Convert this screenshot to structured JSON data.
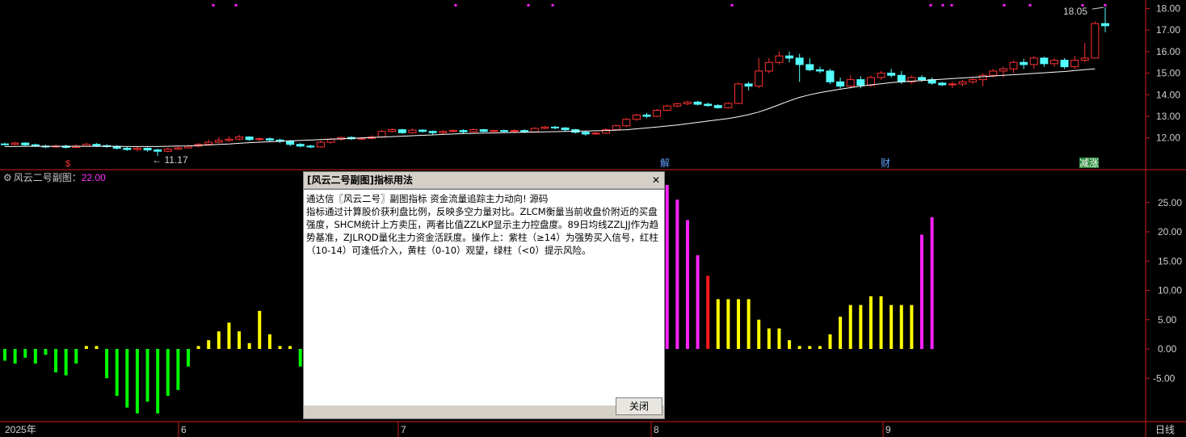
{
  "colors": {
    "up": "#ff3232",
    "down": "#54ffff",
    "ma": "#ffffff",
    "axis": "#c81e1e",
    "bar_purple": "#ff22ff",
    "bar_red": "#ff1a1a",
    "bar_yellow": "#ffff00",
    "bar_green": "#00ff00",
    "marker_purple": "#ff22ff",
    "label_blue": "#5fa0ff"
  },
  "chart_data": [
    {
      "type": "candlestick",
      "name": "main",
      "ylim": [
        11.0,
        18.2
      ],
      "yticks": [
        "18.00",
        "17.00",
        "16.00",
        "15.00",
        "14.00",
        "13.00",
        "12.00"
      ],
      "yticks_values": [
        18,
        17,
        16,
        15,
        14,
        13,
        12
      ],
      "high_annotation": "18.05",
      "low_annotation": "11.17",
      "candles": [
        [
          11.72,
          11.7,
          11.78,
          11.64
        ],
        [
          11.7,
          11.76,
          11.82,
          11.66
        ],
        [
          11.76,
          11.68,
          11.8,
          11.62
        ],
        [
          11.68,
          11.62,
          11.74,
          11.58
        ],
        [
          11.62,
          11.58,
          11.68,
          11.52
        ],
        [
          11.58,
          11.62,
          11.7,
          11.54
        ],
        [
          11.62,
          11.56,
          11.68,
          11.5
        ],
        [
          11.56,
          11.62,
          11.7,
          11.52
        ],
        [
          11.62,
          11.7,
          11.78,
          11.58
        ],
        [
          11.7,
          11.64,
          11.76,
          11.58
        ],
        [
          11.64,
          11.6,
          11.7,
          11.54
        ],
        [
          11.6,
          11.52,
          11.66,
          11.46
        ],
        [
          11.52,
          11.46,
          11.58,
          11.4
        ],
        [
          11.46,
          11.52,
          11.58,
          11.38
        ],
        [
          11.52,
          11.44,
          11.56,
          11.36
        ],
        [
          11.44,
          11.38,
          11.5,
          11.17
        ],
        [
          11.38,
          11.48,
          11.54,
          11.34
        ],
        [
          11.48,
          11.54,
          11.6,
          11.44
        ],
        [
          11.54,
          11.62,
          11.68,
          11.5
        ],
        [
          11.62,
          11.7,
          11.76,
          11.58
        ],
        [
          11.7,
          11.8,
          11.92,
          11.66
        ],
        [
          11.8,
          11.88,
          12.04,
          11.76
        ],
        [
          11.88,
          11.94,
          12.08,
          11.82
        ],
        [
          11.94,
          12.04,
          12.14,
          11.88
        ],
        [
          12.04,
          11.92,
          12.08,
          11.86
        ],
        [
          11.92,
          11.96,
          12.02,
          11.86
        ],
        [
          11.96,
          11.9,
          12.02,
          11.84
        ],
        [
          11.9,
          11.84,
          11.96,
          11.76
        ],
        [
          11.84,
          11.7,
          11.9,
          11.62
        ],
        [
          11.7,
          11.62,
          11.76,
          11.56
        ],
        [
          11.62,
          11.58,
          11.68,
          11.52
        ],
        [
          11.58,
          11.8,
          11.88,
          11.54
        ],
        [
          11.8,
          11.94,
          12.0,
          11.74
        ],
        [
          11.94,
          12.02,
          12.06,
          11.86
        ],
        [
          12.02,
          11.96,
          12.08,
          11.9
        ],
        [
          11.96,
          11.98,
          12.04,
          11.9
        ],
        [
          11.98,
          12.04,
          12.12,
          11.92
        ],
        [
          12.04,
          12.3,
          12.36,
          12.0
        ],
        [
          12.3,
          12.38,
          12.44,
          12.24
        ],
        [
          12.38,
          12.24,
          12.42,
          12.2
        ],
        [
          12.24,
          12.36,
          12.44,
          12.2
        ],
        [
          12.36,
          12.3,
          12.4,
          12.24
        ],
        [
          12.3,
          12.24,
          12.34,
          12.16
        ],
        [
          12.24,
          12.3,
          12.36,
          12.18
        ],
        [
          12.3,
          12.34,
          12.4,
          12.26
        ],
        [
          12.34,
          12.28,
          12.4,
          12.22
        ],
        [
          12.28,
          12.38,
          12.44,
          12.24
        ],
        [
          12.38,
          12.3,
          12.42,
          12.26
        ],
        [
          12.3,
          12.34,
          12.38,
          12.26
        ],
        [
          12.34,
          12.3,
          12.38,
          12.24
        ],
        [
          12.3,
          12.34,
          12.4,
          12.26
        ],
        [
          12.34,
          12.28,
          12.4,
          12.22
        ],
        [
          12.28,
          12.44,
          12.5,
          12.24
        ],
        [
          12.44,
          12.5,
          12.56,
          12.4
        ],
        [
          12.5,
          12.46,
          12.56,
          12.4
        ],
        [
          12.46,
          12.38,
          12.5,
          12.3
        ],
        [
          12.38,
          12.26,
          12.42,
          12.2
        ],
        [
          12.26,
          12.18,
          12.32,
          12.1
        ],
        [
          12.18,
          12.22,
          12.28,
          12.14
        ],
        [
          12.22,
          12.38,
          12.44,
          12.18
        ],
        [
          12.38,
          12.56,
          12.62,
          12.34
        ],
        [
          12.56,
          12.86,
          12.92,
          12.5
        ],
        [
          12.86,
          13.06,
          13.12,
          12.78
        ],
        [
          13.06,
          13.0,
          13.16,
          12.92
        ],
        [
          13.0,
          13.28,
          13.34,
          12.96
        ],
        [
          13.28,
          13.48,
          13.54,
          13.24
        ],
        [
          13.48,
          13.58,
          13.62,
          13.42
        ],
        [
          13.58,
          13.66,
          13.72,
          13.52
        ],
        [
          13.66,
          13.56,
          13.72,
          13.5
        ],
        [
          13.56,
          13.5,
          13.64,
          13.44
        ],
        [
          13.5,
          13.4,
          13.56,
          13.36
        ],
        [
          13.4,
          13.6,
          13.66,
          13.36
        ],
        [
          13.6,
          14.5,
          14.58,
          13.56
        ],
        [
          14.5,
          14.4,
          14.6,
          14.2
        ],
        [
          14.4,
          15.1,
          15.7,
          14.3
        ],
        [
          15.1,
          15.5,
          15.7,
          15.0
        ],
        [
          15.5,
          15.8,
          16.0,
          15.4
        ],
        [
          15.8,
          15.7,
          16.0,
          15.5
        ],
        [
          15.7,
          15.4,
          15.9,
          14.6
        ],
        [
          15.4,
          15.16,
          15.7,
          15.1
        ],
        [
          15.16,
          15.1,
          15.3,
          15.0
        ],
        [
          15.1,
          14.6,
          15.2,
          14.5
        ],
        [
          14.6,
          14.4,
          14.8,
          14.3
        ],
        [
          14.4,
          14.7,
          14.9,
          14.3
        ],
        [
          14.7,
          14.44,
          14.86,
          14.3
        ],
        [
          14.44,
          14.8,
          14.9,
          14.36
        ],
        [
          14.8,
          15.0,
          15.1,
          14.7
        ],
        [
          15.0,
          14.9,
          15.2,
          14.8
        ],
        [
          14.9,
          14.6,
          15.1,
          14.5
        ],
        [
          14.6,
          14.8,
          14.9,
          14.5
        ],
        [
          14.8,
          14.7,
          14.9,
          14.6
        ],
        [
          14.7,
          14.54,
          14.8,
          14.46
        ],
        [
          14.54,
          14.46,
          14.6,
          14.4
        ],
        [
          14.46,
          14.5,
          14.6,
          14.3
        ],
        [
          14.5,
          14.6,
          14.7,
          14.4
        ],
        [
          14.6,
          14.7,
          14.8,
          14.5
        ],
        [
          14.7,
          14.9,
          15.0,
          14.4
        ],
        [
          14.9,
          15.1,
          15.2,
          14.8
        ],
        [
          15.1,
          15.2,
          15.3,
          14.8
        ],
        [
          15.2,
          15.5,
          15.6,
          15.0
        ],
        [
          15.5,
          15.4,
          15.66,
          15.2
        ],
        [
          15.4,
          15.7,
          15.8,
          15.2
        ],
        [
          15.7,
          15.44,
          15.76,
          15.3
        ],
        [
          15.44,
          15.6,
          15.7,
          15.3
        ],
        [
          15.6,
          15.3,
          15.7,
          15.2
        ],
        [
          15.3,
          15.6,
          15.8,
          15.2
        ],
        [
          15.6,
          15.7,
          16.4,
          15.5
        ],
        [
          15.7,
          17.3,
          17.4,
          15.7
        ],
        [
          17.3,
          17.2,
          18.05,
          16.9
        ]
      ],
      "ma": [
        11.6,
        11.6,
        11.61,
        11.61,
        11.61,
        11.61,
        11.61,
        11.61,
        11.61,
        11.61,
        11.61,
        11.61,
        11.6,
        11.6,
        11.6,
        11.6,
        11.61,
        11.62,
        11.63,
        11.65,
        11.67,
        11.7,
        11.72,
        11.75,
        11.78,
        11.8,
        11.82,
        11.84,
        11.86,
        11.88,
        11.9,
        11.92,
        11.94,
        11.96,
        11.98,
        12.0,
        12.02,
        12.04,
        12.06,
        12.08,
        12.1,
        12.12,
        12.14,
        12.16,
        12.18,
        12.2,
        12.21,
        12.22,
        12.23,
        12.24,
        12.25,
        12.26,
        12.27,
        12.28,
        12.29,
        12.3,
        12.31,
        12.32,
        12.33,
        12.34,
        12.36,
        12.38,
        12.42,
        12.46,
        12.5,
        12.55,
        12.6,
        12.66,
        12.72,
        12.78,
        12.84,
        12.9,
        12.98,
        13.08,
        13.2,
        13.36,
        13.54,
        13.72,
        13.88,
        14.0,
        14.1,
        14.18,
        14.26,
        14.33,
        14.4,
        14.46,
        14.51,
        14.56,
        14.6,
        14.63,
        14.66,
        14.69,
        14.72,
        14.75,
        14.78,
        14.81,
        14.84,
        14.87,
        14.9,
        14.93,
        14.96,
        14.99,
        15.02,
        15.05,
        15.08,
        15.12,
        15.16,
        15.2
      ]
    },
    {
      "type": "bar",
      "name": "sub",
      "title": "风云二号副图",
      "current_value": "22.00",
      "ylim": [
        -11.0,
        30.5
      ],
      "yticks": [
        "25.00",
        "20.00",
        "15.00",
        "10.00",
        "5.00",
        "0.00",
        "-5.00"
      ],
      "yticks_values": [
        25,
        20,
        15,
        10,
        5,
        0,
        -5
      ],
      "values": [
        -2.0,
        -2.5,
        -1.5,
        -2.5,
        -1.0,
        -4.0,
        -4.5,
        -2.5,
        0.5,
        0.5,
        -5.0,
        -8.0,
        -10.0,
        -11.0,
        -9.0,
        -11.0,
        -8.0,
        -7.0,
        -3.0,
        0.5,
        1.5,
        3.0,
        4.5,
        3.0,
        1.0,
        6.5,
        2.5,
        0.5,
        0.5,
        -3.0,
        0.5,
        1.0,
        3.0,
        5.5,
        6.5,
        7.0,
        8.0,
        9.0,
        10.0,
        10.5,
        11.0,
        11.5,
        12.0,
        12.5,
        13.0,
        14.0,
        14.5,
        15.0,
        16.0,
        17.0,
        18.0,
        2.5,
        5.5,
        9.5,
        12.0,
        15.5,
        18.0,
        20.5,
        18.0,
        16.5,
        15.0,
        13.5,
        22.0,
        25.5,
        28.0,
        28.0,
        25.5,
        22.0,
        16.0,
        12.5,
        8.5,
        8.5,
        8.5,
        8.5,
        5.0,
        3.5,
        3.5,
        1.5,
        0.5,
        0.5,
        0.5,
        2.5,
        5.5,
        7.5,
        7.5,
        9.0,
        9.0,
        7.5,
        7.5,
        7.5,
        19.5,
        22.5
      ]
    }
  ],
  "x_axis": {
    "labels": [
      "2025年",
      "6",
      "7",
      "8",
      "9"
    ]
  },
  "top_markers": {
    "signal_label": "$",
    "event_labels": [
      "解",
      "财",
      "减涨"
    ]
  },
  "period_label": "日线",
  "dialog": {
    "title": "[风云二号副图]指标用法",
    "body": "通达信〖风云二号〗副图指标 资金流量追踪主力动向! 源码\n指标通过计算股价获利盘比例，反映多空力量对比。ZLCM衡量当前收盘价附近的买盘强度，SHCM统计上方卖压，两者比值ZZLKP显示主力控盘度。89日均线ZZLJJ作为趋势基准，ZJLRQD量化主力资金活跃度。操作上：紫柱（≥14）为强势买入信号，红柱（10-14）可逢低介入，黄柱（0-10）观望，绿柱（<0）提示风险。",
    "close_button": "关闭",
    "close_x": "✕"
  }
}
